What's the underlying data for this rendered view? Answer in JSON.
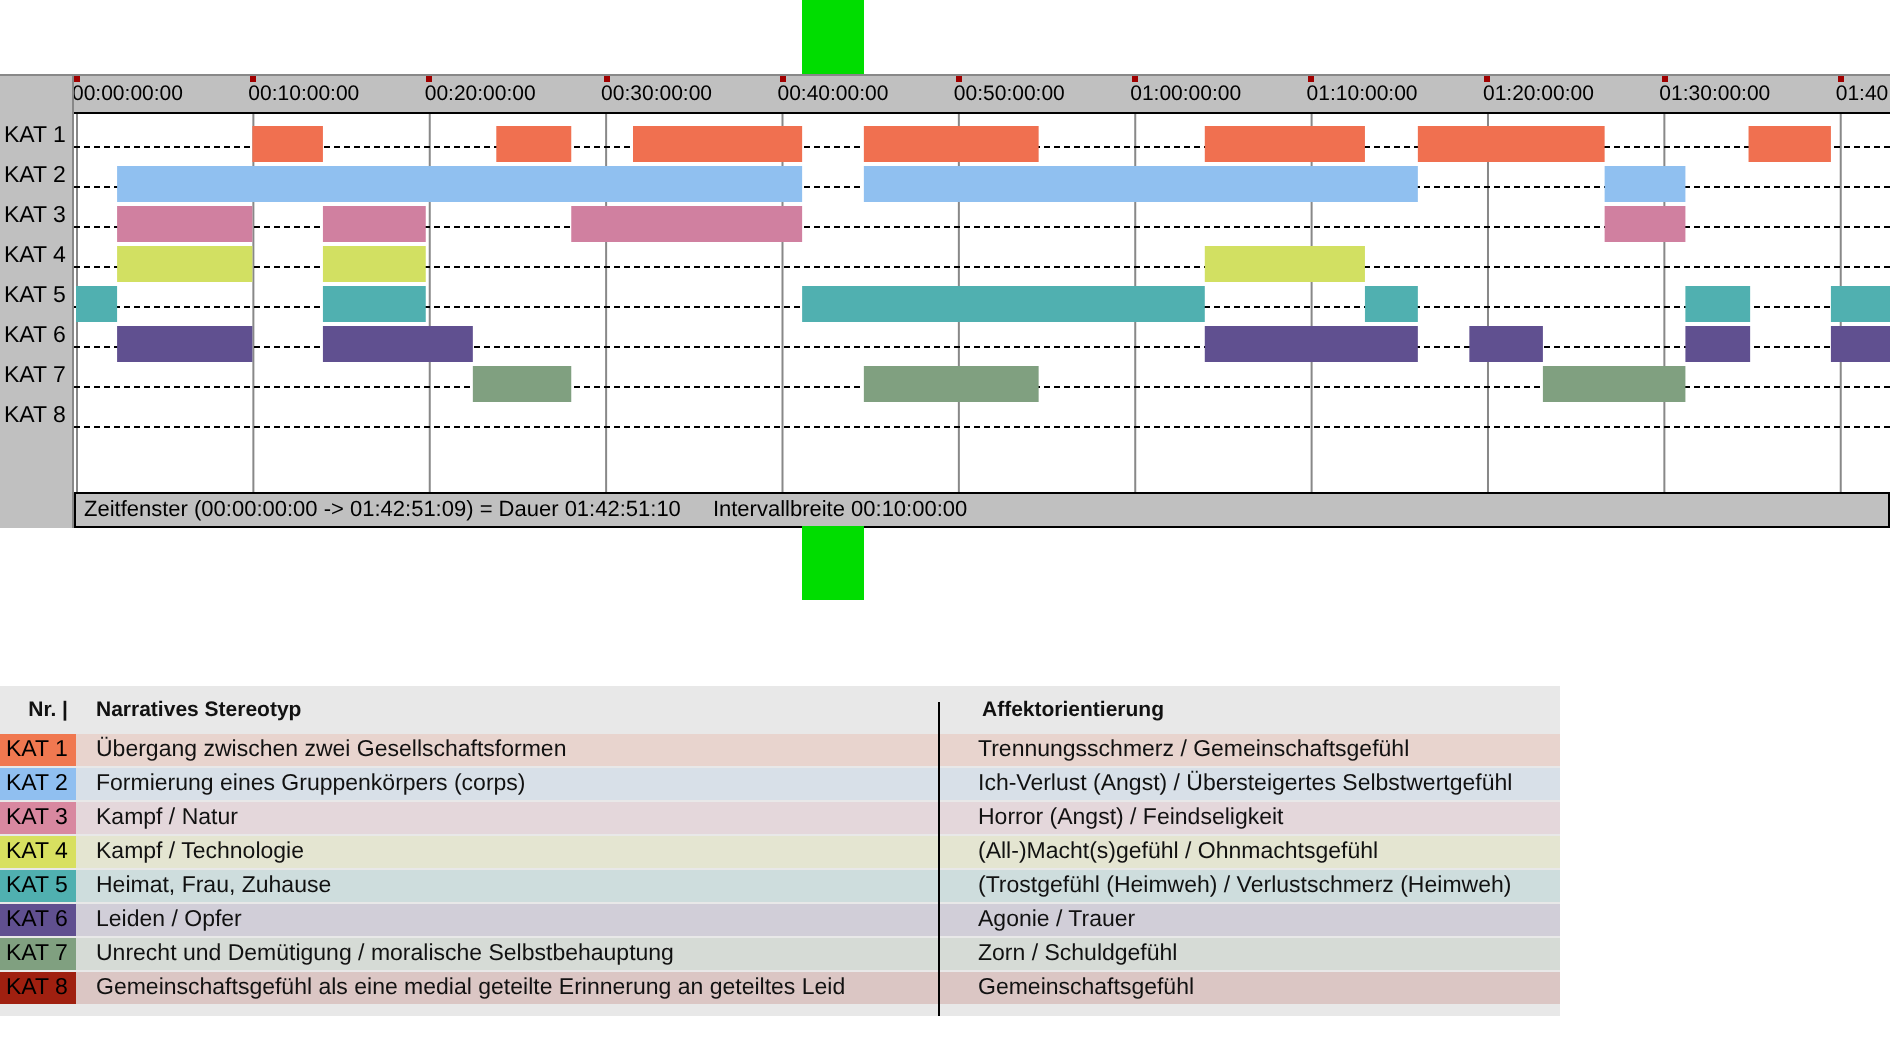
{
  "timeline": {
    "ticks": [
      "00:00:00:00",
      "00:10:00:00",
      "00:20:00:00",
      "00:30:00:00",
      "00:40:00:00",
      "00:50:00:00",
      "01:00:00:00",
      "01:10:00:00",
      "01:20:00:00",
      "01:30:00:00",
      "01:40"
    ],
    "rows": [
      {
        "label": "KAT 1",
        "color": "#f07050"
      },
      {
        "label": "KAT 2",
        "color": "#90c0f0"
      },
      {
        "label": "KAT 3",
        "color": "#d080a0"
      },
      {
        "label": "KAT 4",
        "color": "#d2e062"
      },
      {
        "label": "KAT 5",
        "color": "#50b0b0"
      },
      {
        "label": "KAT 6",
        "color": "#605090"
      },
      {
        "label": "KAT 7",
        "color": "#80a080"
      },
      {
        "label": "KAT 8"
      }
    ],
    "status": [
      "Zeitfenster (00:00:00:00 -> 01:42:51:09) = Dauer 01:42:51:10",
      "Intervallbreite 00:10:00:00"
    ]
  },
  "legend": {
    "columns": [
      "Nr. |",
      "Narratives Stereotyp",
      "Affektorientierung"
    ],
    "rows": [
      {
        "code": "KAT 1",
        "color": "#f07850",
        "stereotype": "Übergang zwischen zwei Gesellschaftsformen",
        "affect": "Trennungsschmerz / Gemeinschaftsgefühl"
      },
      {
        "code": "KAT 2",
        "color": "#90bff0",
        "stereotype": "Formierung eines Gruppenkörpers (corps)",
        "affect": "Ich-Verlust (Angst) / Übersteigertes Selbstwertgefühl"
      },
      {
        "code": "KAT 3",
        "color": "#d888a0",
        "stereotype": "Kampf / Natur",
        "affect": "Horror (Angst) / Feindseligkeit"
      },
      {
        "code": "KAT 4",
        "color": "#d8e060",
        "stereotype": "Kampf / Technologie",
        "affect": "(All-)Macht(s)gefühl / Ohnmachtsgefühl"
      },
      {
        "code": "KAT 5",
        "color": "#50b0b0",
        "stereotype": "Heimat, Frau, Zuhause",
        "affect": "(Trostgefühl (Heimweh) / Verlustschmerz (Heimweh)"
      },
      {
        "code": "KAT 6",
        "color": "#605090",
        "stereotype": "Leiden / Opfer",
        "affect": "Agonie / Trauer"
      },
      {
        "code": "KAT 7",
        "color": "#80a080",
        "stereotype": "Unrecht und Demütigung / moralische Selbstbehauptung",
        "affect": "Zorn / Schuldgefühl"
      },
      {
        "code": "KAT 8",
        "color": "#a02010",
        "stereotype": "Gemeinschaftsgefühl als eine medial geteilte Erinnerung an geteiltes Leid",
        "affect": "Gemeinschaftsgefühl"
      }
    ]
  }
}
